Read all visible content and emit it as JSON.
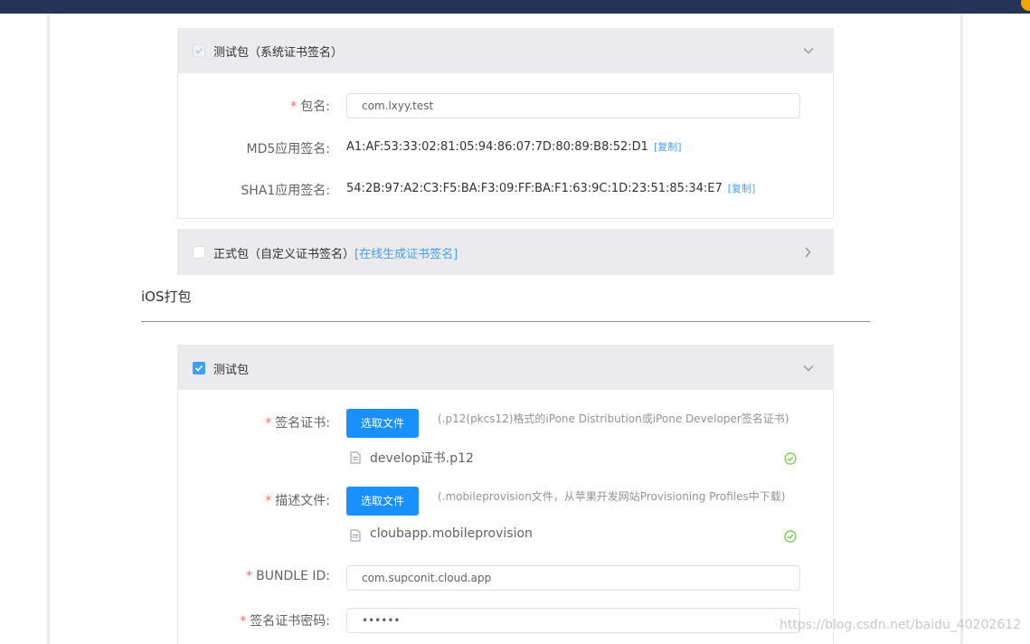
{
  "android": {
    "test_panel": {
      "title": "测试包（系统证书签名）",
      "checked": true,
      "disabled": true,
      "expanded": true,
      "package_label": "包名:",
      "package_value": "com.lxyy.test",
      "md5_label": "MD5应用签名:",
      "md5_value": "A1:AF:53:33:02:81:05:94:86:07:7D:80:89:B8:52:D1",
      "sha1_label": "SHA1应用签名:",
      "sha1_value": "54:2B:97:A2:C3:F5:BA:F3:09:FF:BA:F1:63:9C:1D:23:51:85:34:E7",
      "copy_label": "[复制]"
    },
    "release_panel": {
      "title": "正式包（自定义证书签名）",
      "link": "[在线生成证书签名]",
      "checked": false,
      "expanded": false
    }
  },
  "ios": {
    "section_title": "iOS打包",
    "test_panel": {
      "title": "测试包",
      "checked": true,
      "expanded": true,
      "cert_label": "签名证书:",
      "cert_button": "选取文件",
      "cert_hint": "(.p12(pkcs12)格式的iPone Distribution或iPone Developer签名证书)",
      "cert_file": "develop证书.p12",
      "profile_label": "描述文件:",
      "profile_button": "选取文件",
      "profile_hint": "(.mobileprovision文件，从苹果开发网站Provisioning Profiles中下载)",
      "profile_file": "cloubapp.mobileprovision",
      "bundle_label": "BUNDLE ID:",
      "bundle_value": "com.supconit.cloud.app",
      "password_label": "签名证书密码:",
      "password_value": "••••••"
    }
  },
  "required_mark": "*",
  "watermark": "https://blog.csdn.net/baidu_40202612",
  "colors": {
    "accent": "#409eff",
    "button": "#1890ff",
    "required": "#f56c6c",
    "success": "#67c23a",
    "header_bg": "#ebebee",
    "top_bar": "#253457"
  },
  "icons": {
    "expanded": "chevron-down-icon",
    "collapsed": "chevron-right-icon",
    "file": "document-icon",
    "uploaded": "check-circle-icon"
  }
}
